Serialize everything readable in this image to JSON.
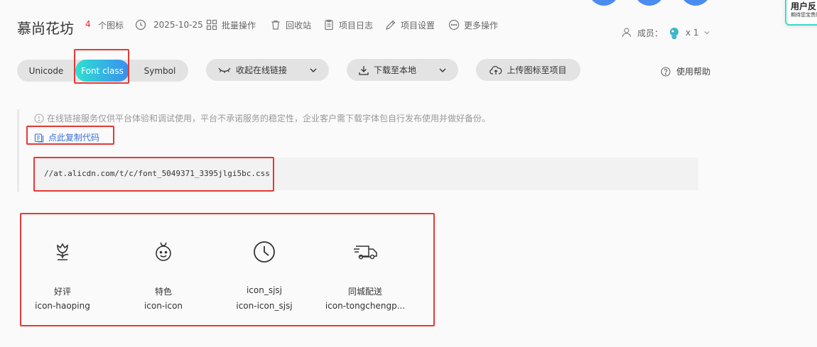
{
  "header": {
    "title": "慕尚花坊",
    "icon_count": "4",
    "icon_count_label": "个图标",
    "date": "2025-10-25",
    "actions": [
      {
        "label": "批量操作",
        "icon": "batch-icon"
      },
      {
        "label": "回收站",
        "icon": "trash-icon"
      },
      {
        "label": "项目日志",
        "icon": "log-icon"
      },
      {
        "label": "项目设置",
        "icon": "settings-icon"
      },
      {
        "label": "更多操作",
        "icon": "more-icon"
      }
    ],
    "members_label": "成员：",
    "members_count": "x 1"
  },
  "feedback": {
    "title": "用户反",
    "subtitle": "期待您宝贵的"
  },
  "tabs": {
    "items": [
      "Unicode",
      "Font class",
      "Symbol"
    ],
    "active": "Font class"
  },
  "toolbar": {
    "collapse_label": "收起在线链接",
    "download_label": "下载至本地",
    "upload_label": "上传图标至项目",
    "help_label": "使用帮助"
  },
  "notice": {
    "text": "在线链接服务仅供平台体验和调试使用，平台不承诺服务的稳定性，企业客户需下载字体包自行发布使用并做好备份。",
    "copy_label": "点此复制代码"
  },
  "code": {
    "url": "//at.alicdn.com/t/c/font_5049371_3395jlgi5bc.css"
  },
  "icons": [
    {
      "name": "好评",
      "class": "icon-haoping",
      "glyph": "flower-icon"
    },
    {
      "name": "特色",
      "class": "icon-icon",
      "glyph": "medal-icon"
    },
    {
      "name": "icon_sjsj",
      "class": "icon-icon_sjsj",
      "glyph": "clock-icon"
    },
    {
      "name": "同城配送",
      "class": "icon-tongchengp...",
      "glyph": "delivery-truck-icon"
    }
  ],
  "colors": {
    "accent_gradient_start": "#2fe0d0",
    "accent_gradient_end": "#3a8df0",
    "count_red": "#f5222d",
    "link_blue": "#3a6fd8",
    "annotation_red": "#e53935"
  }
}
